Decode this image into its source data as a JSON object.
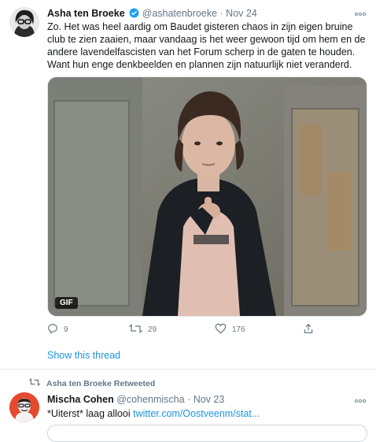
{
  "tweet1": {
    "name": "Asha ten Broeke",
    "handle": "@ashatenbroeke",
    "date": "Nov 24",
    "separator": "·",
    "text": "Zo. Het was heel aardig om Baudet gisteren chaos in zijn eigen bruine club te zien zaaien, maar vandaag is het weer gewoon tijd om hem en de andere lavendelfascisten van het Forum scherp in de gaten te houden. Want hun enge denkbeelden en plannen zijn natuurlijk niet veranderd.",
    "media_badge": "GIF",
    "replies": "9",
    "retweets": "29",
    "likes": "176",
    "show_thread": "Show this thread",
    "icons": [
      "verified-icon",
      "more-icon",
      "reply-icon",
      "retweet-icon",
      "like-icon",
      "share-icon"
    ]
  },
  "retweet_context": {
    "label": "Asha ten Broeke Retweeted"
  },
  "tweet2": {
    "name": "Mischa Cohen",
    "handle": "@cohenmischa",
    "date": "Nov 23",
    "separator": "·",
    "text_plain": "*Uiterst* laag allooi ",
    "text_link": "twitter.com/Oostveenm/stat..."
  },
  "colors": {
    "accent": "#1b95e0",
    "muted": "#657786",
    "text": "#14171a",
    "divider": "#e6ecf0"
  }
}
